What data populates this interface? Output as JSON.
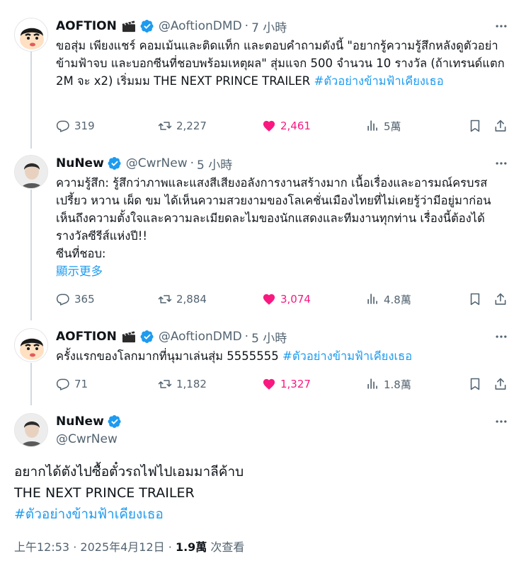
{
  "tweets": [
    {
      "name": "AOFTION",
      "handle": "@AoftionDMD",
      "sep": "·",
      "time": "7 小時",
      "text_before": "ขอสุ่ม เพียงแชร์ คอมเม้นและติดแท็ก และตอบคำถามดังนี้ \"อยากรู้ความรู้สึกหลังดูตัวอย่าข้ามฟ้าจบ และบอกซีนที่ชอบพร้อมเหตุผล\" สุ่มแจก 500 จำนวน 10 รางวัล (ถ้าเทรนด์แตก 2M จะ x2) เริ่มมม  THE NEXT PRINCE TRAILER  ",
      "hashtag": "#ตัวอย่างข้ามฟ้าเคียงเธอ",
      "replies": "319",
      "retweets": "2,227",
      "likes": "2,461",
      "views": "5萬"
    },
    {
      "name": "NuNew",
      "handle": "@CwrNew",
      "sep": "·",
      "time": "5 小時",
      "text": "ความรู้สึก: รู้สึกว่าภาพและแสงสีเสียงอลังการงานสร้างมาก เนื้อเรื่องและอารมณ์ครบรสเปรี้ยว หวาน เผ็ด ขม ได้เห็นความสวยงามของโลเคชั่นเมืองไทยที่ไม่เคยรู้ว่ามีอยู่มาก่อน เห็นถึงความตั้งใจและความละเมียดละไมของนักแสดงและทีมงานทุกท่าน เรื่องนี้ต้องได้รางวัลซีรีส์แห่งปี!!",
      "text2": "ซีนที่ชอบ:",
      "show_more": "顯示更多",
      "replies": "365",
      "retweets": "2,884",
      "likes": "3,074",
      "views": "4.8萬"
    },
    {
      "name": "AOFTION",
      "handle": "@AoftionDMD",
      "sep": "·",
      "time": "5 小時",
      "text_before": "ครั้งแรกของโลกมากที่นุมาเล่นสุ่ม 5555555 ",
      "hashtag": "#ตัวอย่างข้ามฟ้าเคียงเธอ",
      "replies": "71",
      "retweets": "1,182",
      "likes": "1,327",
      "views": "1.8萬"
    }
  ],
  "main_tweet": {
    "name": "NuNew",
    "handle": "@CwrNew",
    "line1": "อยากได้ตังไปซื้อตั๋วรถไฟไปเอมมาลีค้าบ",
    "line2": "THE NEXT PRINCE TRAILER",
    "hashtag": "#ตัวอย่างข้ามฟ้าเคียงเธอ",
    "time": "上午12:53",
    "sep1": "·",
    "date": "2025年4月12日",
    "sep2": "·",
    "views": "1.9萬",
    "views_label": "次查看"
  },
  "colors": {
    "accent": "#1d9bf0",
    "like": "#f91880",
    "muted": "#536471",
    "text": "#0f1419"
  },
  "icons": [
    "clapperboard-icon",
    "verified-badge-icon",
    "more-icon",
    "reply-icon",
    "retweet-icon",
    "like-icon",
    "views-icon",
    "bookmark-icon",
    "share-icon"
  ]
}
